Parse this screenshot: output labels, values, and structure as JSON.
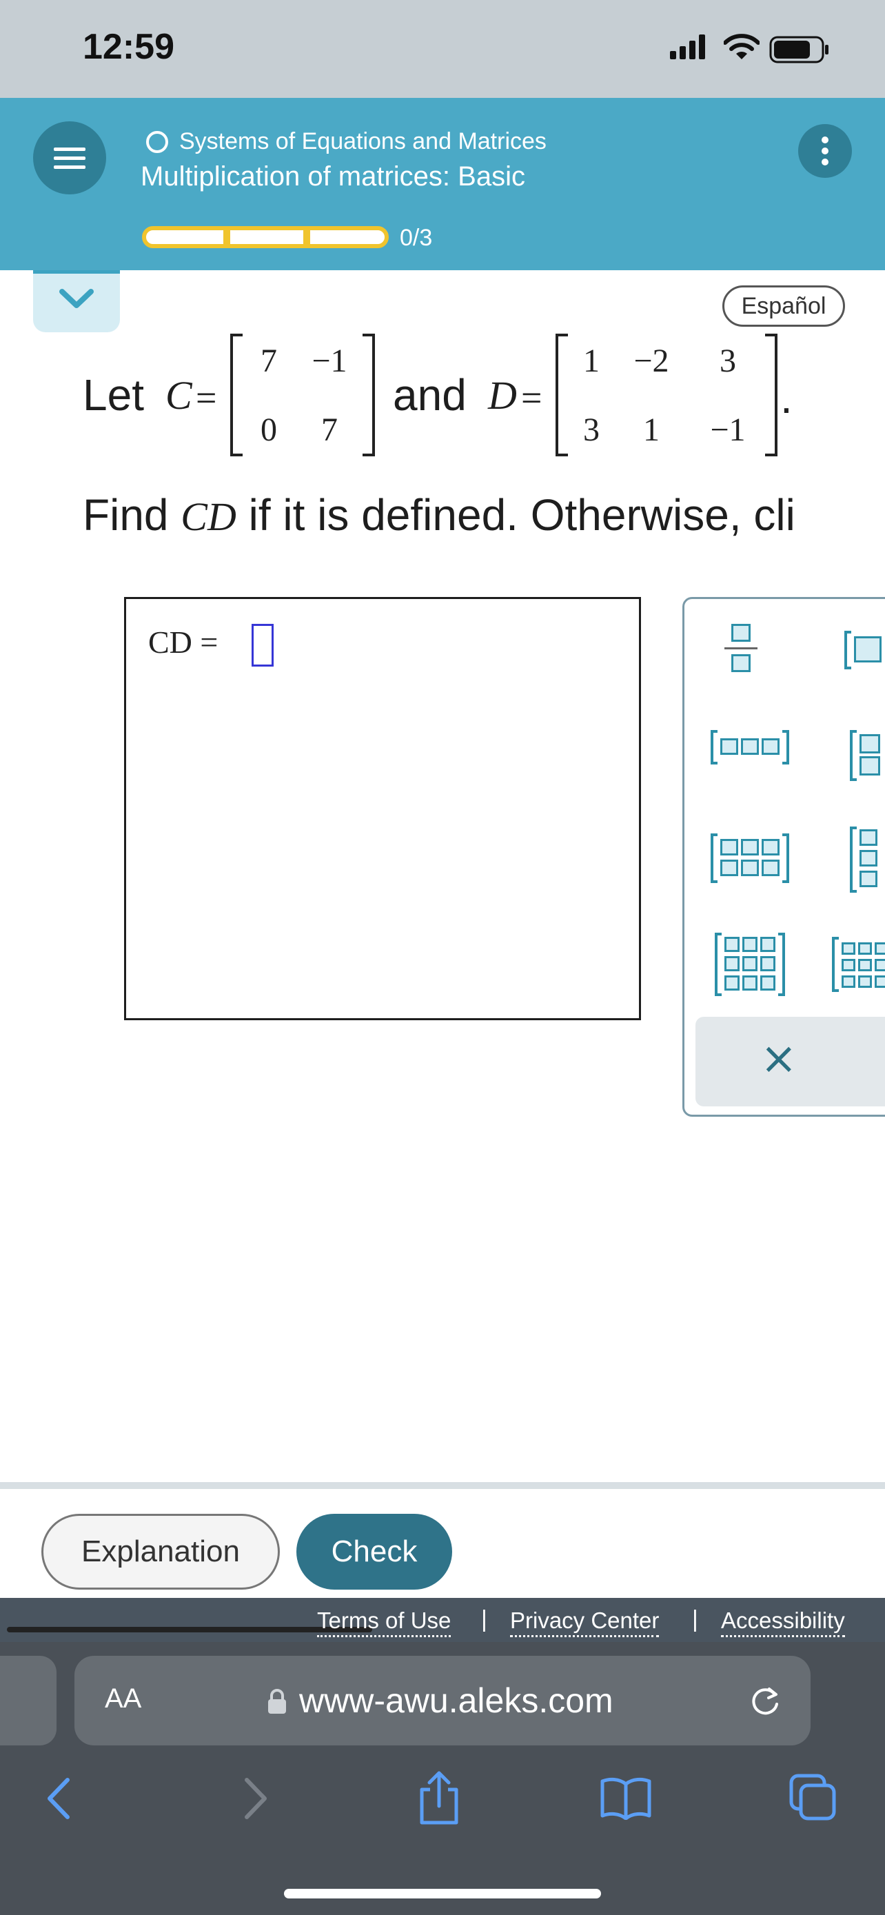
{
  "status_bar": {
    "time": "12:59"
  },
  "header": {
    "course": "Systems of Equations and Matrices",
    "topic": "Multiplication of matrices: Basic",
    "progress_text": "0/3",
    "progress_fraction": 0
  },
  "language_button": "Español",
  "problem": {
    "let_text": "Let",
    "c_var": "C",
    "d_var": "D",
    "equals": "=",
    "and_text": "and",
    "period": ".",
    "matrix_c": [
      [
        "7",
        "−1"
      ],
      [
        "0",
        "7"
      ]
    ],
    "matrix_d": [
      [
        "1",
        "−2",
        "3"
      ],
      [
        "3",
        "1",
        "−1"
      ]
    ],
    "find_text": "Find",
    "find_var": "CD",
    "find_rest": "if it is defined. Otherwise, cli"
  },
  "answer": {
    "label": "CD =",
    "value": ""
  },
  "palette": {
    "clear_symbol": "×"
  },
  "actions": {
    "explanation": "Explanation",
    "check": "Check"
  },
  "footer": {
    "terms": "Terms of Use",
    "privacy": "Privacy Center",
    "accessibility": "Accessibility",
    "separator": "|"
  },
  "browser": {
    "aa": "AA",
    "url": "www-awu.aleks.com"
  },
  "colors": {
    "header": "#4ba9c6",
    "progress": "#f0c42d",
    "check_button": "#2f7389",
    "accent": "#2b8fa8"
  }
}
